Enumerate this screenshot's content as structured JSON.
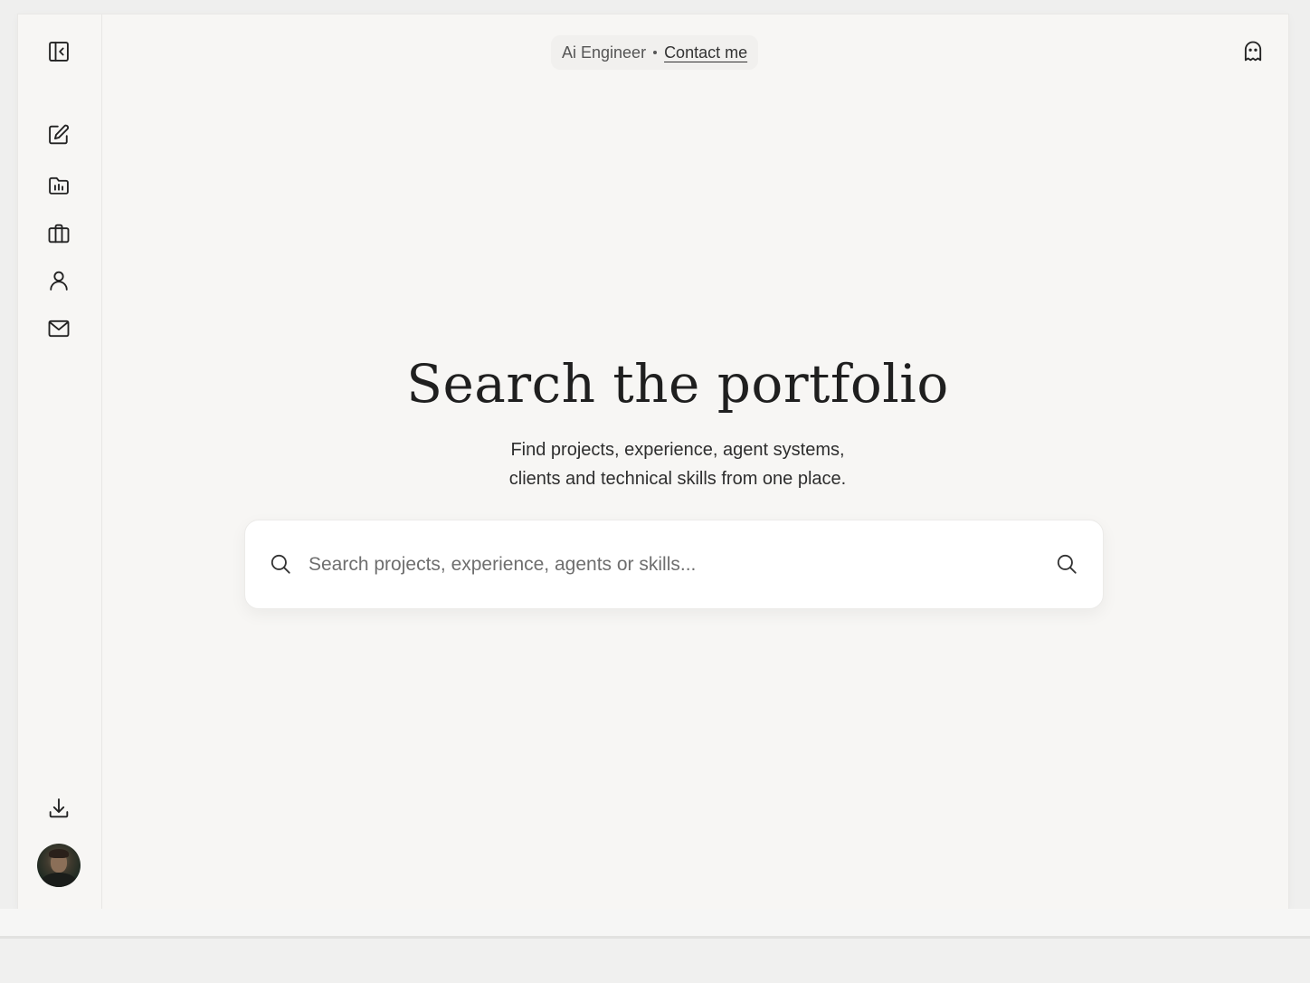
{
  "header": {
    "role_text": "Ai Engineer",
    "contact_link": "Contact me"
  },
  "sidebar": {
    "top_items": [
      {
        "icon": "sidebar-collapse-icon"
      },
      {
        "icon": "edit-icon"
      },
      {
        "icon": "folder-chart-icon"
      },
      {
        "icon": "briefcase-icon"
      },
      {
        "icon": "user-icon"
      },
      {
        "icon": "mail-icon"
      }
    ],
    "bottom_items": [
      {
        "icon": "download-icon"
      },
      {
        "icon": "avatar"
      }
    ]
  },
  "hero": {
    "title": "Search the portfolio",
    "subtitle_line1": "Find projects, experience, agent systems,",
    "subtitle_line2": "clients and technical skills from one place."
  },
  "search": {
    "placeholder": "Search projects, experience, agents or skills...",
    "value": ""
  },
  "top_right": {
    "icon": "ghost-icon"
  },
  "colors": {
    "background": "#f7f6f4",
    "text": "#1f1f1f",
    "card": "#ffffff"
  }
}
